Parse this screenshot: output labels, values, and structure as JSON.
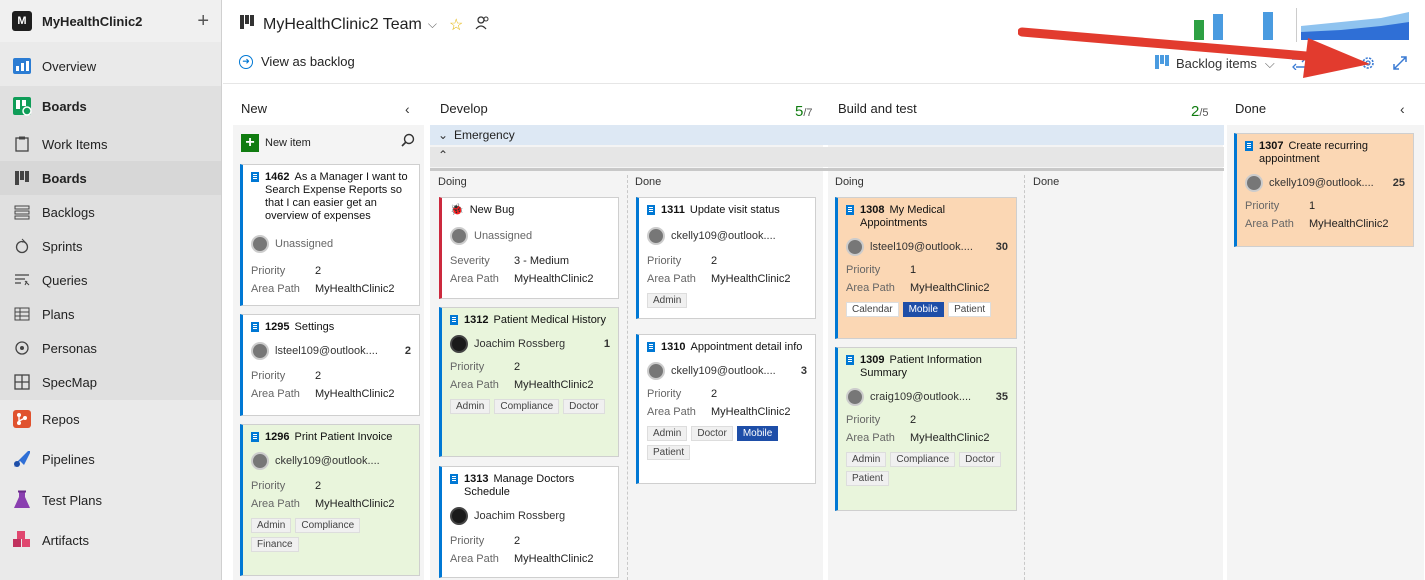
{
  "org": {
    "logo_letter": "M",
    "name": "MyHealthClinic2"
  },
  "nav": {
    "overview": "Overview",
    "boards_group": "Boards",
    "work_items": "Work Items",
    "boards": "Boards",
    "backlogs": "Backlogs",
    "sprints": "Sprints",
    "queries": "Queries",
    "plans": "Plans",
    "personas": "Personas",
    "specmap": "SpecMap",
    "repos": "Repos",
    "pipelines": "Pipelines",
    "test_plans": "Test Plans",
    "artifacts": "Artifacts"
  },
  "header": {
    "team": "MyHealthClinic2 Team",
    "view_as_backlog": "View as backlog",
    "backlog_items": "Backlog items"
  },
  "columns": {
    "new": "New",
    "develop": "Develop",
    "develop_count": "5",
    "develop_limit": "/7",
    "build": "Build and test",
    "build_count": "2",
    "build_limit": "/5",
    "done": "Done",
    "doing": "Doing",
    "done_sub": "Done",
    "new_item": "New item",
    "emergency": "Emergency"
  },
  "labels": {
    "priority": "Priority",
    "area_path": "Area Path",
    "severity": "Severity"
  },
  "cards": {
    "c1462": {
      "id": "1462",
      "title": "As a Manager I want to Search Expense Reports so that I can easier get an overview of expenses",
      "assignee": "Unassigned",
      "priority": "2",
      "area": "MyHealthClinic2"
    },
    "c1295": {
      "id": "1295",
      "title": "Settings",
      "assignee": "lsteel109@outlook....",
      "estimate": "2",
      "priority": "2",
      "area": "MyHealthClinic2"
    },
    "c1296": {
      "id": "1296",
      "title": "Print Patient Invoice",
      "assignee": "ckelly109@outlook....",
      "priority": "2",
      "area": "MyHealthClinic2",
      "tags": [
        "Admin",
        "Compliance",
        "Finance"
      ]
    },
    "bug": {
      "title": "New Bug",
      "assignee": "Unassigned",
      "severity": "3 - Medium",
      "area": "MyHealthClinic2"
    },
    "c1312": {
      "id": "1312",
      "title": "Patient Medical History",
      "assignee": "Joachim Rossberg",
      "estimate": "1",
      "priority": "2",
      "area": "MyHealthClinic2",
      "tags": [
        "Admin",
        "Compliance",
        "Doctor"
      ]
    },
    "c1313": {
      "id": "1313",
      "title": "Manage Doctors Schedule",
      "assignee": "Joachim Rossberg",
      "priority": "2",
      "area": "MyHealthClinic2"
    },
    "c1311": {
      "id": "1311",
      "title": "Update visit status",
      "assignee": "ckelly109@outlook....",
      "priority": "2",
      "area": "MyHealthClinic2",
      "tags": [
        "Admin"
      ]
    },
    "c1310": {
      "id": "1310",
      "title": "Appointment detail info",
      "assignee": "ckelly109@outlook....",
      "estimate": "3",
      "priority": "2",
      "area": "MyHealthClinic2",
      "tags": [
        "Admin",
        "Doctor",
        "Mobile",
        "Patient"
      ]
    },
    "c1308": {
      "id": "1308",
      "title": "My Medical Appointments",
      "assignee": "lsteel109@outlook....",
      "estimate": "30",
      "priority": "1",
      "area": "MyHealthClinic2",
      "tags": [
        "Calendar",
        "Mobile",
        "Patient"
      ]
    },
    "c1309": {
      "id": "1309",
      "title": "Patient Information Summary",
      "assignee": "craig109@outlook....",
      "estimate": "35",
      "priority": "2",
      "area": "MyHealthClinic2",
      "tags": [
        "Admin",
        "Compliance",
        "Doctor",
        "Patient"
      ]
    },
    "c1307": {
      "id": "1307",
      "title": "Create recurring appointment",
      "assignee": "ckelly109@outlook....",
      "estimate": "25",
      "priority": "1",
      "area": "MyHealthClinic2"
    }
  }
}
